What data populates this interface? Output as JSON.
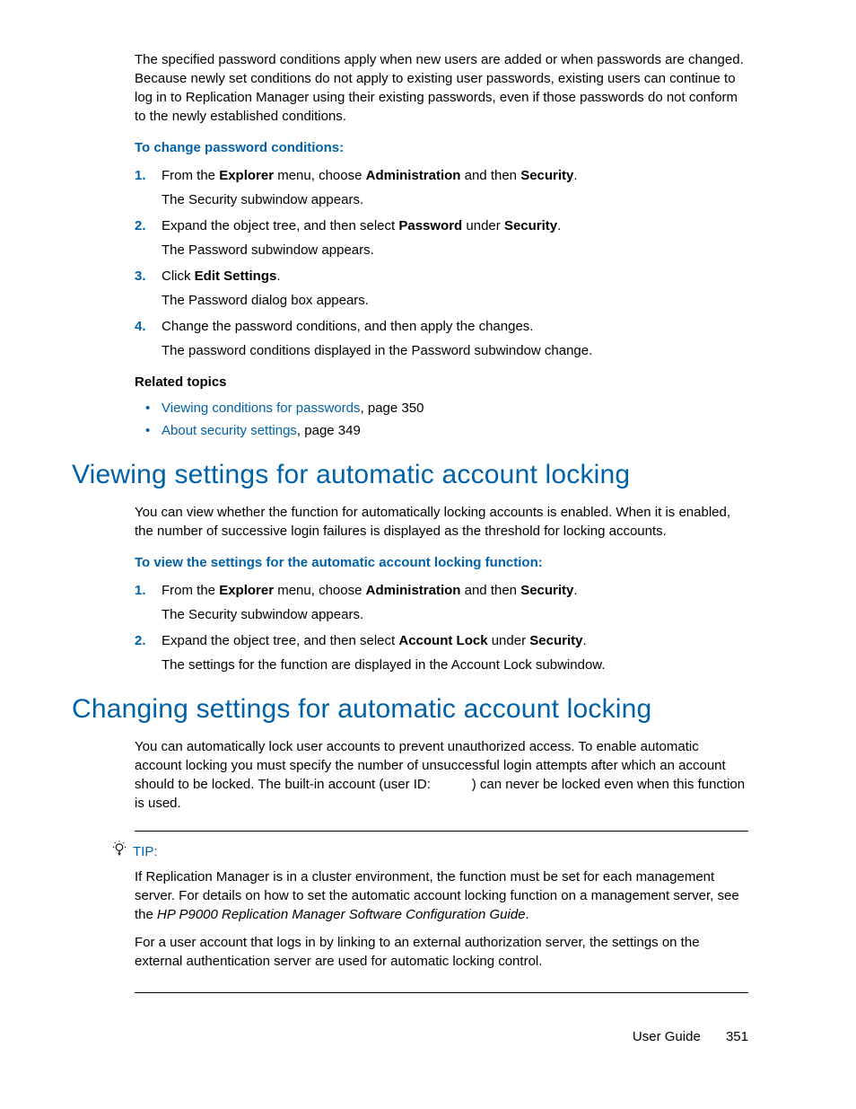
{
  "intro": "The specified password conditions apply when new users are added or when passwords are changed. Because newly set conditions do not apply to existing user passwords, existing users can continue to log in to Replication Manager using their existing passwords, even if those passwords do not conform to the newly established conditions.",
  "proc1_head": "To change password conditions:",
  "proc1": {
    "n1": "1.",
    "s1a": "From the ",
    "s1b": "Explorer",
    "s1c": " menu, choose ",
    "s1d": "Administration",
    "s1e": " and then ",
    "s1f": "Security",
    "s1g": ".",
    "s1sub": "The Security subwindow appears.",
    "n2": "2.",
    "s2a": "Expand the object tree, and then select ",
    "s2b": "Password",
    "s2c": " under ",
    "s2d": "Security",
    "s2e": ".",
    "s2sub": "The Password subwindow appears.",
    "n3": "3.",
    "s3a": "Click ",
    "s3b": "Edit Settings",
    "s3c": ".",
    "s3sub": "The Password dialog box appears.",
    "n4": "4.",
    "s4a": "Change the password conditions, and then apply the changes.",
    "s4sub": "The password conditions displayed in the Password subwindow change."
  },
  "related_head": "Related topics",
  "related": {
    "r1link": "Viewing conditions for passwords",
    "r1rest": ", page 350",
    "r2link": "About security settings",
    "r2rest": ", page 349"
  },
  "h_view": "Viewing settings for automatic account locking",
  "view_intro": "You can view whether the function for automatically locking accounts is enabled. When it is enabled, the number of successive login failures is displayed as the threshold for locking accounts.",
  "proc2_head": "To view the settings for the automatic account locking function:",
  "proc2": {
    "n1": "1.",
    "s1a": "From the ",
    "s1b": "Explorer",
    "s1c": " menu, choose ",
    "s1d": "Administration",
    "s1e": " and then ",
    "s1f": "Security",
    "s1g": ".",
    "s1sub": "The Security subwindow appears.",
    "n2": "2.",
    "s2a": "Expand the object tree, and then select ",
    "s2b": "Account Lock",
    "s2c": " under ",
    "s2d": "Security",
    "s2e": ".",
    "s2sub": "The settings for the function are displayed in the Account Lock subwindow."
  },
  "h_change": "Changing settings for automatic account locking",
  "change_intro_a": "You can automatically lock user accounts to prevent unauthorized access. To enable automatic account locking you must specify the number of unsuccessful login attempts after which an account should to be locked. The built-in account (user ID: ",
  "change_intro_b": ") can never be locked even when this function is used.",
  "tip_label": "TIP:",
  "tip_p1a": "If Replication Manager is in a cluster environment, the function must be set for each management server. For details on how to set the automatic account locking function on a management server, see the ",
  "tip_p1b": "HP P9000 Replication Manager Software Configuration Guide",
  "tip_p1c": ".",
  "tip_p2": "For a user account that logs in by linking to an external authorization server, the settings on the external authentication server are used for automatic locking control.",
  "footer_label": "User Guide",
  "footer_page": "351"
}
